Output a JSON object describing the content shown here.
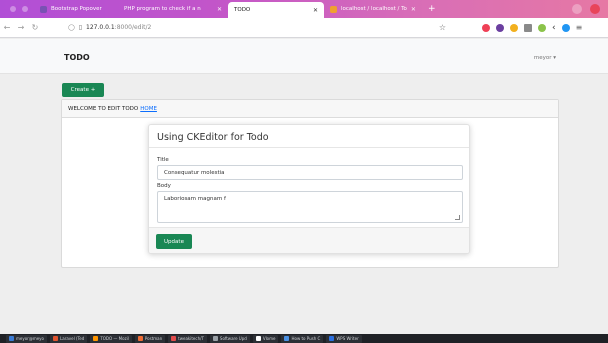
{
  "browser": {
    "tabs": [
      {
        "title": "Bootstrap Popover",
        "active": false,
        "favicon_color": "#7952b3"
      },
      {
        "title": "PHP program to check if a n",
        "active": false,
        "favicon_color": "#f5a623"
      },
      {
        "title": "TODO",
        "active": true,
        "favicon_color": "#cccccc"
      },
      {
        "title": "localhost / localhost / To",
        "active": false,
        "favicon_color": "#f0a030"
      }
    ],
    "url": {
      "host": "127.0.0.1",
      "path": ":8000/edit/2"
    }
  },
  "navbar": {
    "brand": "TODO",
    "user": "meyor ▾"
  },
  "create_button": "Create +",
  "card_header": {
    "text": "WELCOME TO EDIT TODO",
    "link": "HOME"
  },
  "form": {
    "heading": "Using CKEditor for Todo",
    "title_label": "Title",
    "title_value": "Consequatur molestia",
    "body_label": "Body",
    "body_value": "Laboriosam magnam f",
    "submit_label": "Update"
  },
  "taskbar": [
    {
      "label": "meyor@meyo",
      "color": "#3a7bd5"
    },
    {
      "label": "Laravel (Ted",
      "color": "#e0542f"
    },
    {
      "label": "TODO — Mozil",
      "color": "#ff9500"
    },
    {
      "label": "Postman",
      "color": "#ef6c35"
    },
    {
      "label": "tweakitech/T",
      "color": "#e34c4c"
    },
    {
      "label": "Software Upd",
      "color": "#9aa0a6"
    },
    {
      "label": "Vlome",
      "color": "#ffffff"
    },
    {
      "label": "How to Push C",
      "color": "#4a90e2"
    },
    {
      "label": "WPS Writer",
      "color": "#2b6fe0"
    }
  ],
  "colors": {
    "primary_button": "#198754",
    "link": "#0d6efd"
  }
}
